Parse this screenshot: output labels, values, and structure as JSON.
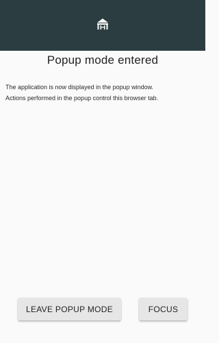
{
  "header": {
    "logo_icon": "pavilion-logo-icon",
    "background": "#2b3d40"
  },
  "main": {
    "title": "Popup mode entered",
    "description_lines": [
      "The application is now displayed in the popup window.",
      "Actions performed in the popup control this browser tab."
    ]
  },
  "actions": {
    "leave_label": "LEAVE POPUP MODE",
    "focus_label": "FOCUS"
  }
}
